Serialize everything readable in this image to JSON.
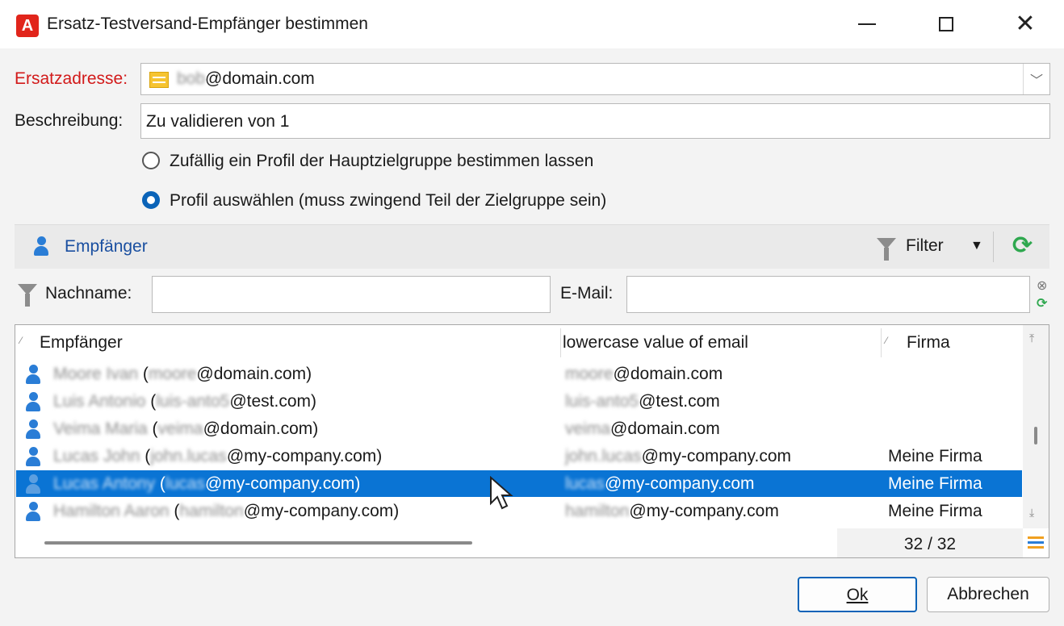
{
  "window": {
    "title": "Ersatz-Testversand-Empfänger bestimmen",
    "app_icon_glyph": "A"
  },
  "form": {
    "ersatzadresse_label": "Ersatzadresse:",
    "ersatzadresse_local_blurred": "bob",
    "ersatzadresse_domain": "@domain.com",
    "beschreibung_label": "Beschreibung:",
    "beschreibung_value": "Zu validieren von 1",
    "radio_random_label": "Zufällig ein Profil der Hauptzielgruppe bestimmen lassen",
    "radio_select_label": "Profil auswählen (muss zwingend Teil der Zielgruppe sein)",
    "selected_radio": "select"
  },
  "toolbar": {
    "title": "Empfänger",
    "filter_label": "Filter"
  },
  "filter_row": {
    "nachname_label": "Nachname:",
    "nachname_value": "",
    "email_label": "E-Mail:",
    "email_value": ""
  },
  "table": {
    "columns": [
      "Empfänger",
      "lowercase value of email",
      "Firma"
    ],
    "rows": [
      {
        "name": "Moore Ivan",
        "local": "moore",
        "domain": "@domain.com)",
        "email_local": "moore",
        "email_domain": "@domain.com",
        "firma": ""
      },
      {
        "name": "Luis Antonio",
        "local": "luis-anto5",
        "domain": "@test.com)",
        "email_local": "luis-anto5",
        "email_domain": "@test.com",
        "firma": ""
      },
      {
        "name": "Veima Maria",
        "local": "veima",
        "domain": "@domain.com)",
        "email_local": "veima",
        "email_domain": "@domain.com",
        "firma": ""
      },
      {
        "name": "Lucas John",
        "local": "john.lucas",
        "domain": "@my-company.com)",
        "email_local": "john.lucas",
        "email_domain": "@my-company.com",
        "firma": "Meine Firma"
      },
      {
        "name": "Lucas Antony",
        "local": "lucas",
        "domain": "@my-company.com)",
        "email_local": "lucas",
        "email_domain": "@my-company.com",
        "firma": "Meine Firma"
      },
      {
        "name": "Hamilton Aaron",
        "local": "hamilton",
        "domain": "@my-company.com)",
        "email_local": "hamilton",
        "email_domain": "@my-company.com",
        "firma": "Meine Firma"
      }
    ],
    "selected_row": 4,
    "count_text": "32 / 32"
  },
  "buttons": {
    "ok_label": "Ok",
    "cancel_label": "Abbrechen"
  },
  "colors": {
    "accent": "#0a74d4",
    "required_label": "#d21a1a",
    "refresh": "#2fa84f"
  }
}
